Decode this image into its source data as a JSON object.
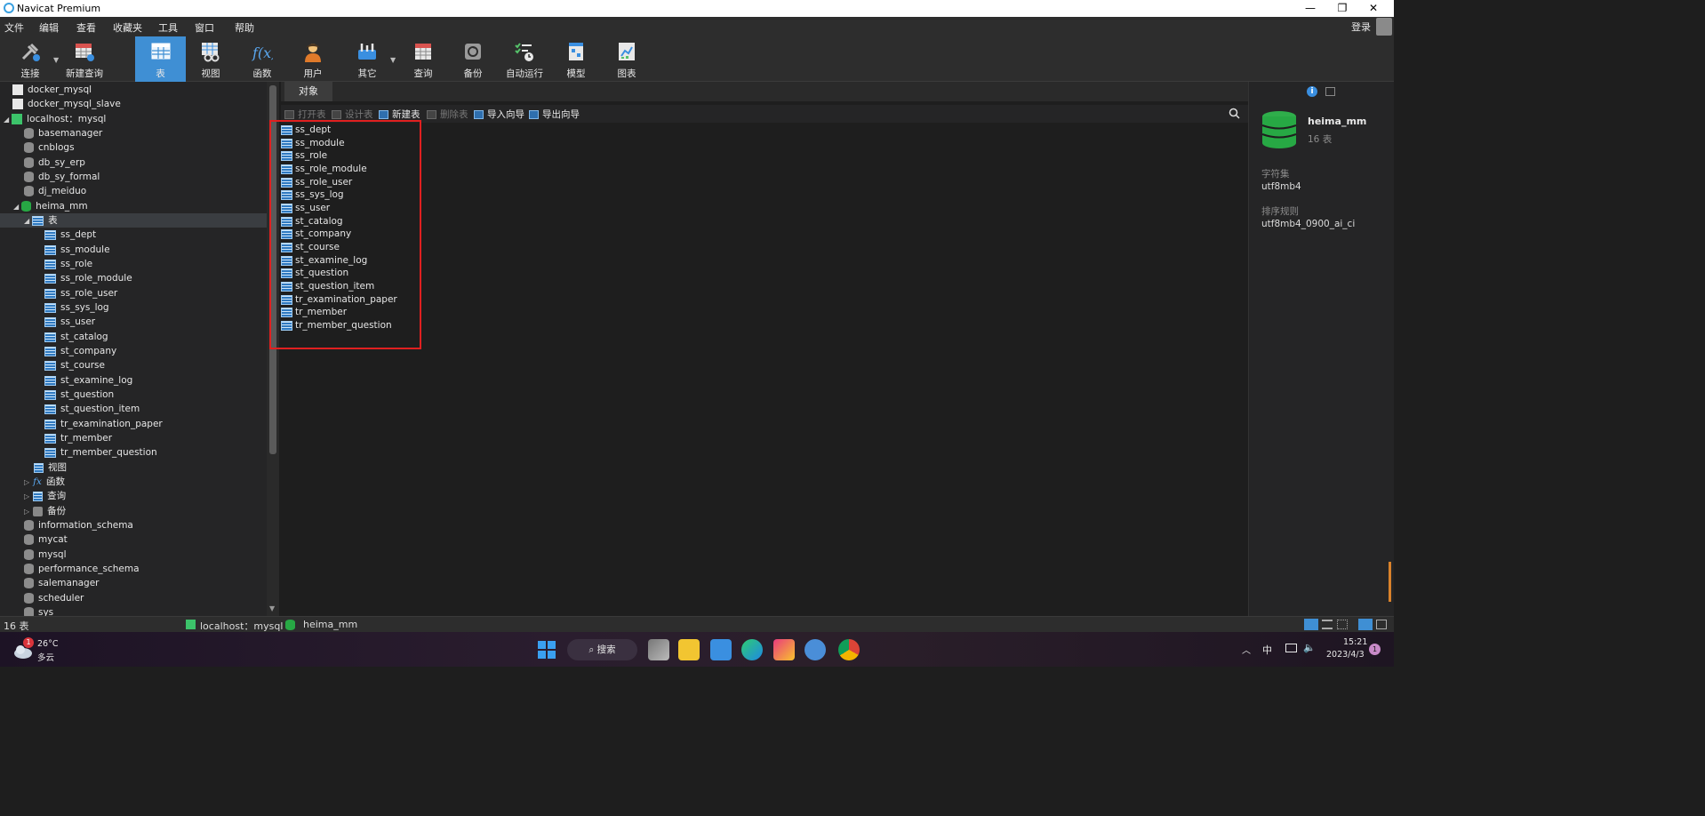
{
  "window": {
    "title": "Navicat Premium"
  },
  "menu": {
    "items": [
      "文件",
      "编辑",
      "查看",
      "收藏夹",
      "工具",
      "窗口",
      "帮助"
    ],
    "login": "登录"
  },
  "toolbar": {
    "items": [
      {
        "label": "连接",
        "icon": "plug-icon"
      },
      {
        "label": "新建查询",
        "icon": "new-query-icon"
      },
      {
        "label": "表",
        "icon": "table-icon",
        "active": true
      },
      {
        "label": "视图",
        "icon": "view-icon"
      },
      {
        "label": "函数",
        "icon": "function-icon"
      },
      {
        "label": "用户",
        "icon": "user-icon"
      },
      {
        "label": "其它",
        "icon": "tools-icon"
      },
      {
        "label": "查询",
        "icon": "query-icon"
      },
      {
        "label": "备份",
        "icon": "backup-icon"
      },
      {
        "label": "自动运行",
        "icon": "automation-icon"
      },
      {
        "label": "模型",
        "icon": "model-icon"
      },
      {
        "label": "图表",
        "icon": "chart-icon"
      }
    ]
  },
  "sidebar": {
    "connections": [
      "docker_mysql",
      "docker_mysql_slave",
      "localhost：mysql"
    ],
    "databases_before": [
      "basemanager",
      "cnblogs",
      "db_sy_erp",
      "db_sy_formal",
      "dj_meiduo"
    ],
    "open_database": "heima_mm",
    "tables_node": "表",
    "tables": [
      "ss_dept",
      "ss_module",
      "ss_role",
      "ss_role_module",
      "ss_role_user",
      "ss_sys_log",
      "ss_user",
      "st_catalog",
      "st_company",
      "st_course",
      "st_examine_log",
      "st_question",
      "st_question_item",
      "tr_examination_paper",
      "tr_member",
      "tr_member_question"
    ],
    "other_nodes": [
      "视图",
      "函数",
      "查询",
      "备份"
    ],
    "databases_after": [
      "information_schema",
      "mycat",
      "mysql",
      "performance_schema",
      "salemanager",
      "scheduler",
      "sys"
    ]
  },
  "tabs": {
    "objects": "对象"
  },
  "object_toolbar": {
    "open": "打开表",
    "design": "设计表",
    "new": "新建表",
    "delete": "删除表",
    "import": "导入向导",
    "export": "导出向导"
  },
  "info": {
    "db_name": "heima_mm",
    "table_count": "16 表",
    "charset_label": "字符集",
    "charset": "utf8mb4",
    "collation_label": "排序规则",
    "collation": "utf8mb4_0900_ai_ci"
  },
  "status": {
    "count": "16 表",
    "connection": "localhost：mysql",
    "database": "heima_mm"
  },
  "taskbar": {
    "temp": "26°C",
    "weather": "多云",
    "weather_badge": "1",
    "search": "搜索",
    "ime": "中",
    "time": "15:21",
    "date": "2023/4/3",
    "notif": "1"
  }
}
